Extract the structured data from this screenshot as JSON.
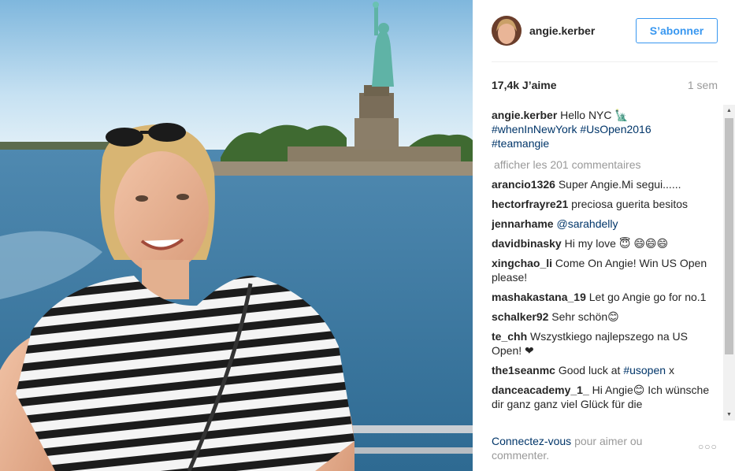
{
  "post": {
    "username": "angie.kerber",
    "follow_label": "S’abonner",
    "likes": "17,4k J’aime",
    "time": "1 sem",
    "caption": {
      "author": "angie.kerber",
      "text": "Hello NYC 🗽",
      "tags": [
        "#whenInNewYork",
        "#UsOpen2016",
        "#teamangie"
      ]
    },
    "load_more": "afficher les 201 commentaires",
    "comments": [
      {
        "author": "arancio1326",
        "text": "Super Angie.Mi segui......"
      },
      {
        "author": "hectorfrayre21",
        "text": "preciosa guerita besitos"
      },
      {
        "author": "jennarhame",
        "text": "",
        "mention": "@sarahdelly"
      },
      {
        "author": "davidbinasky",
        "text": "Hi my love 😇 😄😄😄"
      },
      {
        "author": "xingchao_li",
        "text": "Come On Angie! Win US Open please!"
      },
      {
        "author": "mashakastana_19",
        "text": "Let go Angie go for no.1"
      },
      {
        "author": "schalker92",
        "text": "Sehr schön😊"
      },
      {
        "author": "te_chh",
        "text": "Wszystkiego najlepszego na US Open! ❤"
      },
      {
        "author": "the1seanmc",
        "text": "Good luck at",
        "tag": "#usopen",
        "after": "x"
      },
      {
        "author": "danceacademy_1_",
        "text": "Hi Angie😊 Ich wünsche dir ganz ganz viel Glück für die"
      }
    ],
    "footer": {
      "login": "Connectez-vous",
      "rest": "pour aimer ou commenter."
    },
    "more_icon": "ellipsis-icon"
  }
}
